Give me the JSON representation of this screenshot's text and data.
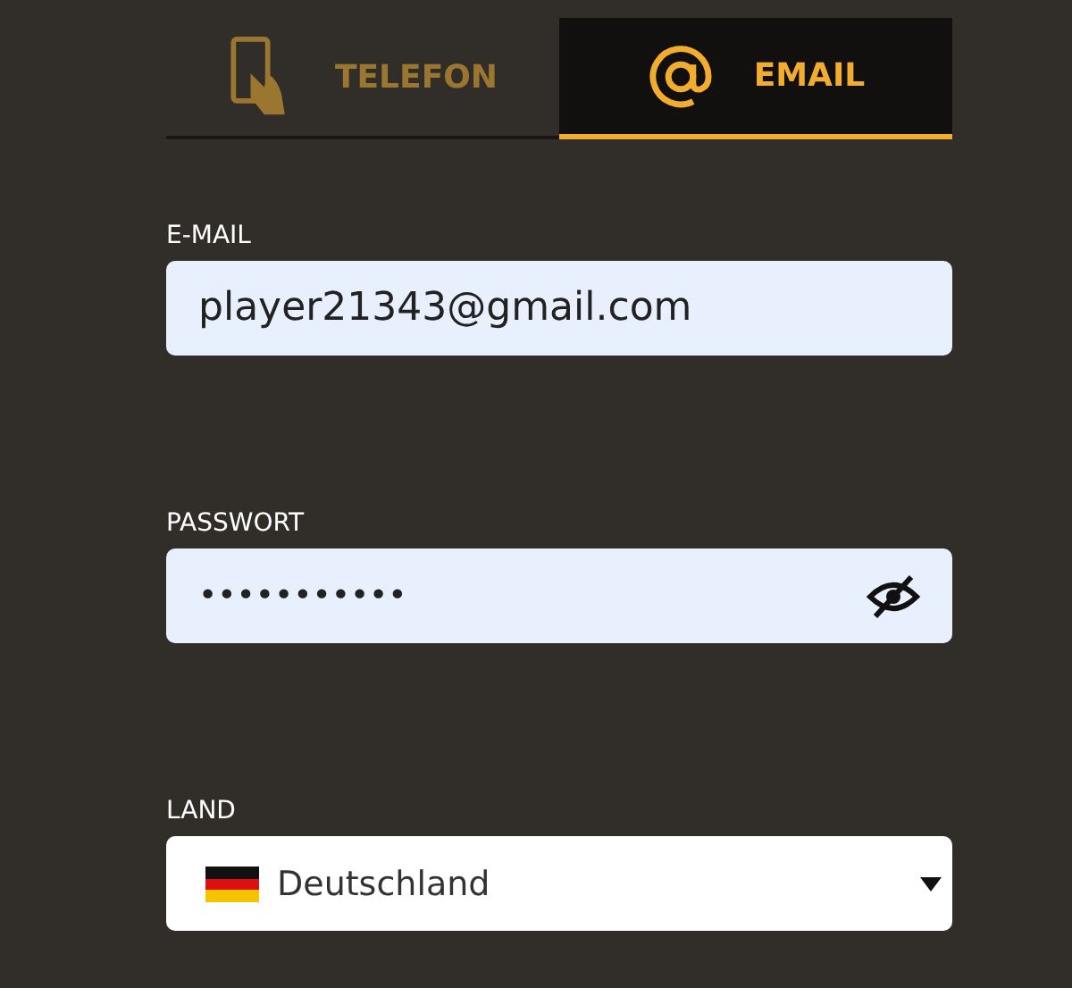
{
  "tabs": [
    {
      "label": "TELEFON",
      "kind": "phone",
      "selected": false
    },
    {
      "label": "EMAIL",
      "kind": "email",
      "selected": true
    }
  ],
  "fields": [
    {
      "kind": "text",
      "label": "E-MAIL",
      "value": "player21343@gmail.com"
    },
    {
      "kind": "password",
      "label": "PASSWORT",
      "value": "•••••••••••",
      "visible": false
    },
    {
      "kind": "select",
      "label": "LAND",
      "value": "Deutschland"
    }
  ]
}
